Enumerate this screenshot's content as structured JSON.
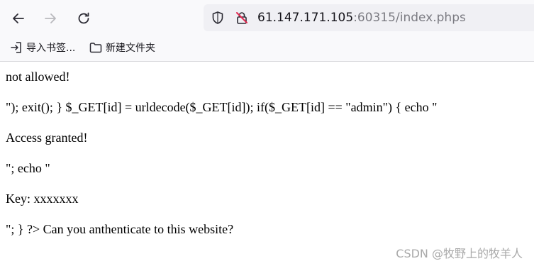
{
  "toolbar": {
    "url_host": "61.147.171.105",
    "url_rest": ":60315/index.phps"
  },
  "bookmarks": {
    "import_label": "导入书签...",
    "folder_label": "新建文件夹"
  },
  "page": {
    "lines": [
      "not allowed!",
      "\"); exit(); } $_GET[id] = urldecode($_GET[id]); if($_GET[id] == \"admin\") { echo \"",
      "Access granted!",
      "\"; echo \"",
      "Key: xxxxxxx",
      "\"; } ?> Can you anthenticate to this website?"
    ]
  },
  "watermark": "CSDN @牧野上的牧羊人"
}
